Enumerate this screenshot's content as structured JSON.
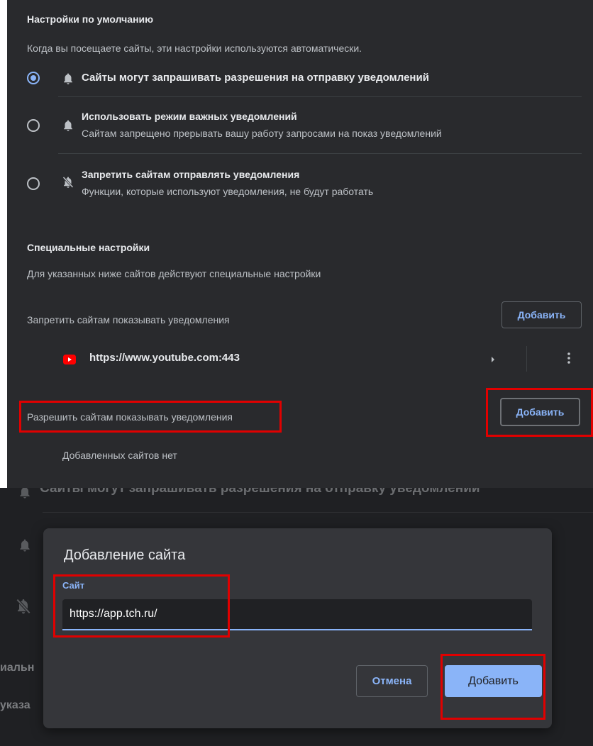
{
  "defaults": {
    "title": "Настройки по умолчанию",
    "description": "Когда вы посещаете сайты, эти настройки используются автоматически.",
    "options": [
      {
        "label": "Сайты могут запрашивать разрешения на отправку уведомлений",
        "sub": "",
        "checked": true
      },
      {
        "label": "Использовать режим важных уведомлений",
        "sub": "Сайтам запрещено прерывать вашу работу запросами на показ уведомлений",
        "checked": false
      },
      {
        "label": "Запретить сайтам отправлять уведомления",
        "sub": "Функции, которые используют уведомления, не будут работать",
        "checked": false
      }
    ]
  },
  "custom": {
    "title": "Специальные настройки",
    "description": "Для указанных ниже сайтов действуют специальные настройки",
    "block": {
      "label": "Запретить сайтам показывать уведомления",
      "add_label": "Добавить",
      "sites": [
        {
          "url": "https://www.youtube.com:443",
          "icon": "youtube-icon"
        }
      ]
    },
    "allow": {
      "label": "Разрешить сайтам показывать уведомления",
      "add_label": "Добавить",
      "empty_text": "Добавленных сайтов нет"
    }
  },
  "background": {
    "option_text": "Сайты могут запрашивать разрешения на отправку уведомлений",
    "frag1": "иальн",
    "frag2": "указа"
  },
  "dialog": {
    "title": "Добавление сайта",
    "field_label": "Сайт",
    "field_value": "https://app.tch.ru/",
    "cancel_label": "Отмена",
    "add_label": "Добавить"
  },
  "colors": {
    "panel_bg": "#292a2d",
    "dialog_bg": "#35363a",
    "accent": "#8ab4f8",
    "highlight": "#e10000",
    "youtube": "#ff0000"
  }
}
